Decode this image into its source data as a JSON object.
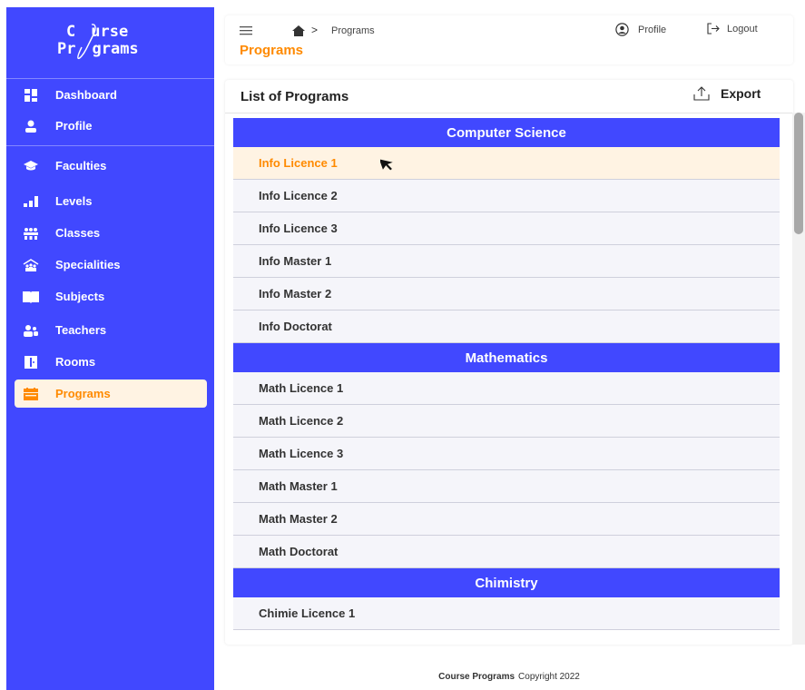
{
  "logo": {
    "line1": "urse",
    "line1_prefix": "C",
    "line2_prefix": "Pr",
    "line2": "grams"
  },
  "sidebar": {
    "items": [
      {
        "label": "Dashboard",
        "icon": "dashboard-grid-icon"
      },
      {
        "label": "Profile",
        "icon": "user-icon"
      },
      {
        "label": "Faculties",
        "icon": "graduation-cap-icon"
      },
      {
        "label": "Levels",
        "icon": "bar-levels-icon"
      },
      {
        "label": "Classes",
        "icon": "group-icon"
      },
      {
        "label": "Specialities",
        "icon": "specialities-icon"
      },
      {
        "label": "Subjects",
        "icon": "book-icon"
      },
      {
        "label": "Teachers",
        "icon": "teachers-icon"
      },
      {
        "label": "Rooms",
        "icon": "door-icon"
      },
      {
        "label": "Programs",
        "icon": "calendar-icon",
        "active": true
      }
    ]
  },
  "header": {
    "breadcrumb_separator": ">",
    "breadcrumb": "Programs",
    "title": "Programs",
    "profile_label": "Profile",
    "logout_label": "Logout"
  },
  "card": {
    "title": "List of Programs",
    "export_label": "Export"
  },
  "groups": [
    {
      "name": "Computer Science",
      "programs": [
        "Info Licence 1",
        "Info Licence 2",
        "Info Licence 3",
        "Info Master 1",
        "Info Master 2",
        "Info Doctorat"
      ]
    },
    {
      "name": "Mathematics",
      "programs": [
        "Math Licence 1",
        "Math Licence 2",
        "Math Licence 3",
        "Math Master 1",
        "Math Master 2",
        "Math Doctorat"
      ]
    },
    {
      "name": "Chimistry",
      "programs": [
        "Chimie Licence 1"
      ]
    }
  ],
  "selected_program": "Info Licence 1",
  "footer": {
    "brand": "Course Programs",
    "text": "Copyright 2022"
  },
  "colors": {
    "primary": "#4148ff",
    "accent": "#ff8a00",
    "selected_bg": "#fff3e3"
  }
}
